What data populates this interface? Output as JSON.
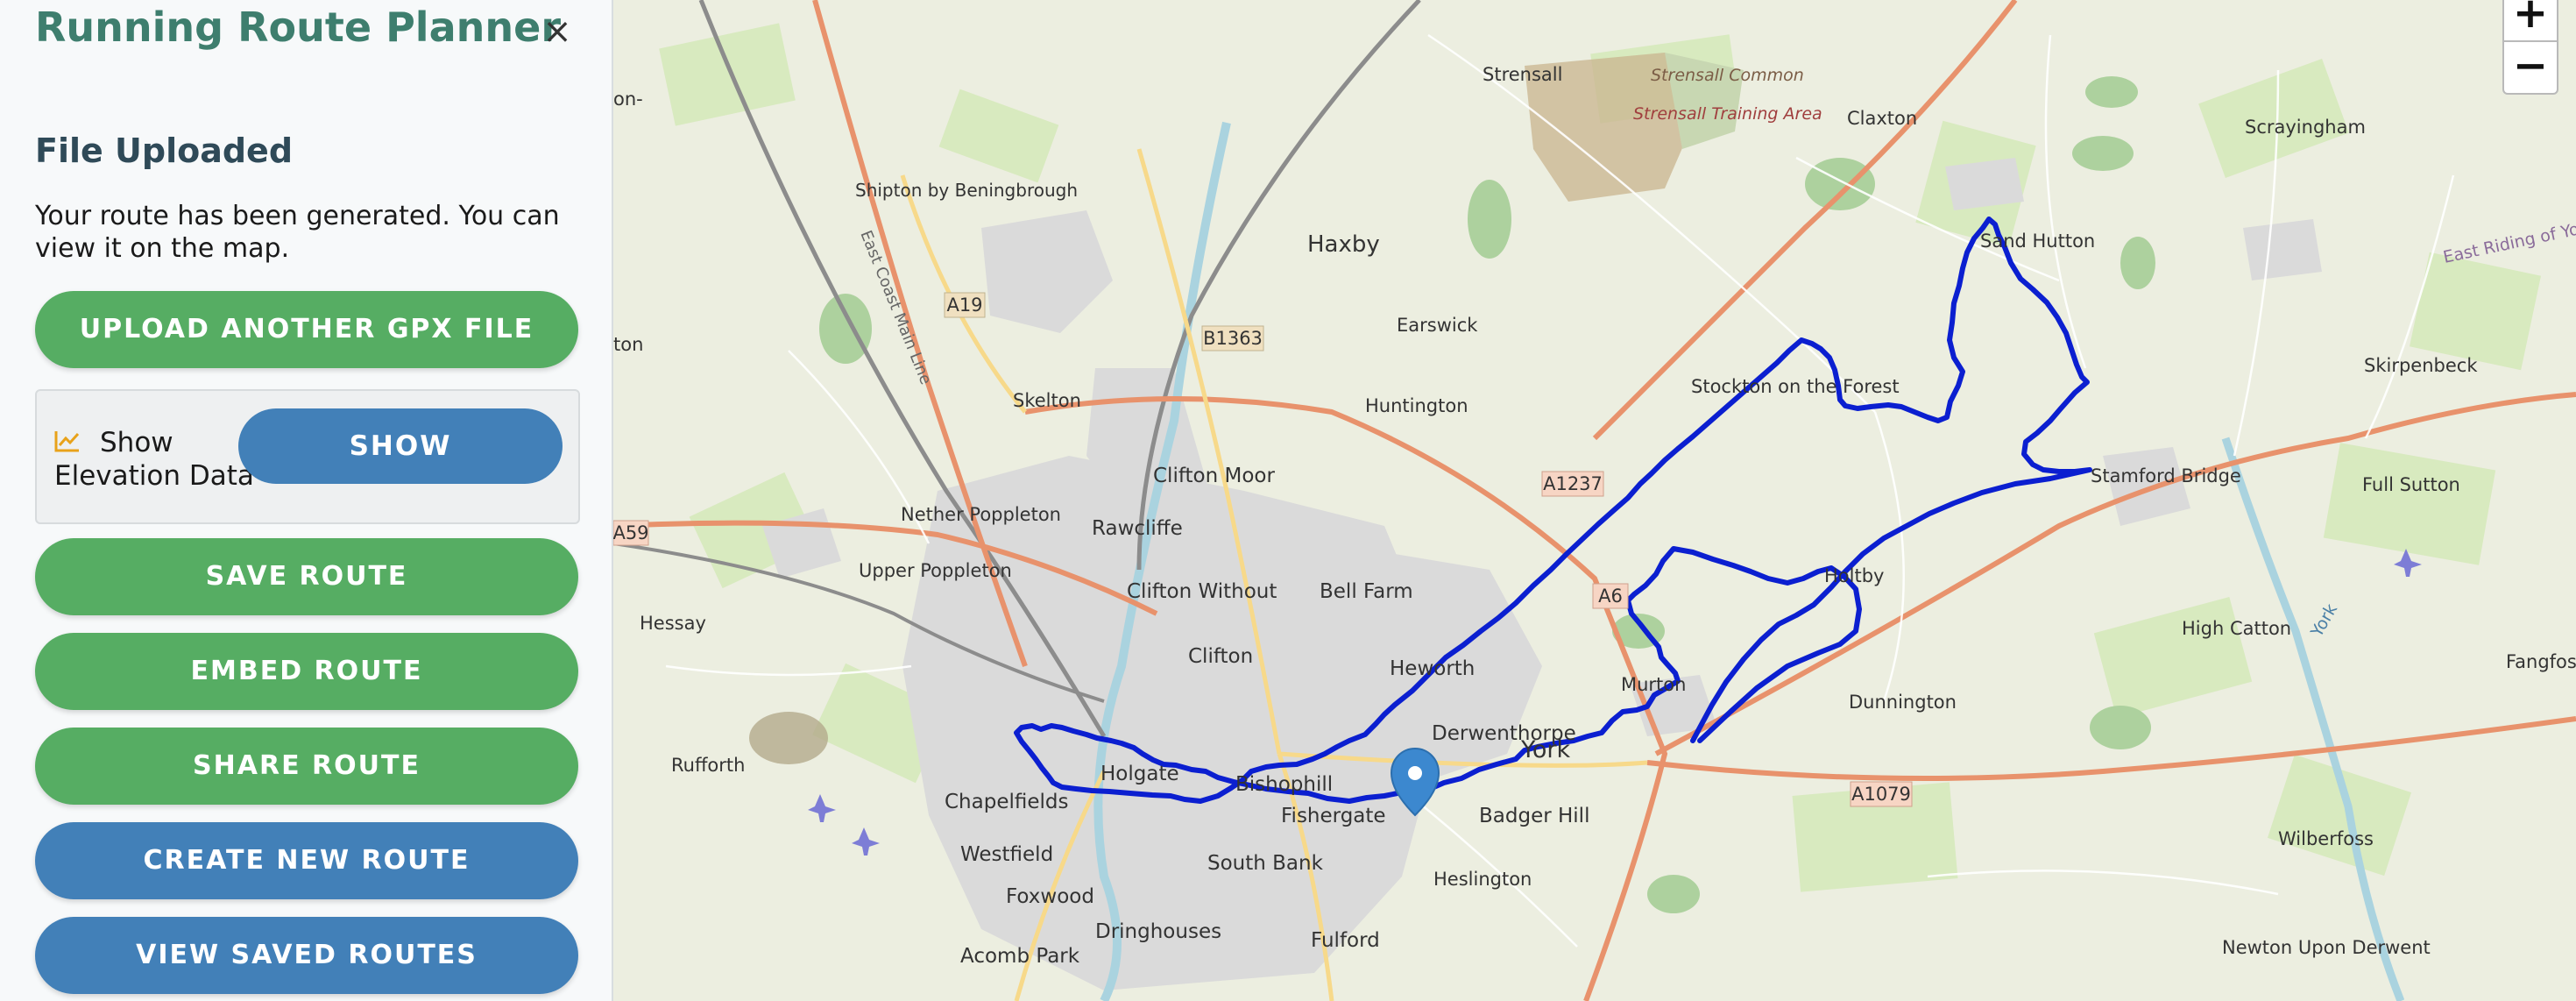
{
  "panel": {
    "title": "Running Route Planner",
    "close_symbol": "×",
    "heading": "File Uploaded",
    "message": "Your route has been generated. You can view it on the map.",
    "upload_button": "UPLOAD ANOTHER GPX FILE",
    "elevation": {
      "label_line1": "Show",
      "label_line2": "Elevation Data",
      "icon": "chart-line-icon",
      "button": "SHOW"
    },
    "buttons": {
      "save": "SAVE ROUTE",
      "embed": "EMBED ROUTE",
      "share": "SHARE ROUTE",
      "create": "CREATE NEW ROUTE",
      "view_saved": "VIEW SAVED ROUTES"
    }
  },
  "colors": {
    "title": "#3e7e6e",
    "green_button": "#56ad63",
    "blue_button": "#4280b8",
    "route_line": "#0b1fd0",
    "marker": "#3c88cf"
  },
  "map": {
    "zoom_in": "+",
    "zoom_out": "−",
    "places": {
      "york": "York",
      "haxby": "Haxby",
      "strensall": "Strensall",
      "strensall_common": "Strensall Common",
      "training_area": "Strensall Training Area",
      "claxton": "Claxton",
      "scrayingham": "Scrayingham",
      "sand_hutton": "Sand Hutton",
      "east_riding": "East Riding of Yorkshire",
      "shipton": "Shipton by Beningbrough",
      "east_coast_main_line": "East Coast Main Line",
      "earswick": "Earswick",
      "huntington": "Huntington",
      "stockton": "Stockton on the Forest",
      "skirpenbeck": "Skirpenbeck",
      "skelton": "Skelton",
      "clifton_moor": "Clifton Moor",
      "rawcliffe": "Rawcliffe",
      "nether_poppleton": "Nether Poppleton",
      "upper_poppleton": "Upper Poppleton",
      "clifton_without": "Clifton Without",
      "bell_farm": "Bell Farm",
      "stamford_bridge": "Stamford Bridge",
      "full_sutton": "Full Sutton",
      "holtby": "Holtby",
      "hessay": "Hessay",
      "clifton": "Clifton",
      "heworth": "Heworth",
      "murton": "Murton",
      "high_catton": "High Catton",
      "fangfoss": "Fangfoss",
      "dunnington": "Dunnington",
      "rufforth": "Rufforth",
      "holgate": "Holgate",
      "derwenthorpe": "Derwenthorpe",
      "bishophill": "Bishophill",
      "chapelfields": "Chapelfields",
      "fishergate": "Fishergate",
      "badger_hill": "Badger Hill",
      "westfield": "Westfield",
      "south_bank": "South Bank",
      "heslington": "Heslington",
      "wilberfoss": "Wilberfoss",
      "foxwood": "Foxwood",
      "dringhouses": "Dringhouses",
      "fulford": "Fulford",
      "acomb_park": "Acomb Park",
      "newton_upon_derwent": "Newton Upon Derwent",
      "york_river": "York",
      "ton_left": "ton",
      "on_left": "on-"
    },
    "roads": {
      "a19": "A19",
      "b1363": "B1363",
      "a1237": "A1237",
      "a59": "A59",
      "a64": "A6",
      "a1079": "A1079"
    }
  }
}
